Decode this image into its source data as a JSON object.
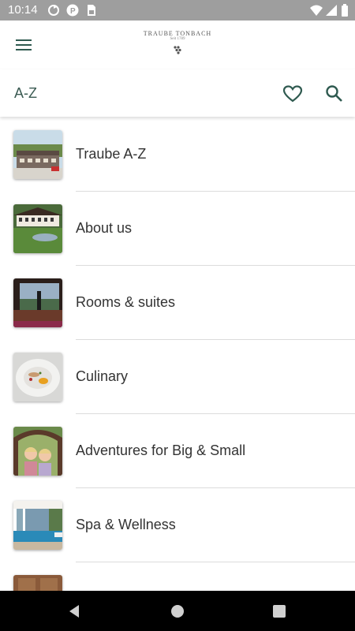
{
  "status_bar": {
    "time": "10:14",
    "icons": [
      "sync-icon",
      "p-badge-icon",
      "sim-card-icon",
      "wifi-icon",
      "signal-icon",
      "battery-icon"
    ]
  },
  "header": {
    "logo_name": "TRAUBE TONBACH",
    "logo_sub": "Seit 1789",
    "menu_icon": "hamburger-menu-icon"
  },
  "toolbar": {
    "title": "A-Z",
    "favorite_icon": "heart-icon",
    "search_icon": "search-icon"
  },
  "items": [
    {
      "label": "Traube A-Z"
    },
    {
      "label": "About us"
    },
    {
      "label": "Rooms & suites"
    },
    {
      "label": "Culinary"
    },
    {
      "label": "Adventures for Big & Small"
    },
    {
      "label": "Spa & Wellness"
    },
    {
      "label": ""
    }
  ],
  "nav": {
    "back_icon": "back-triangle-icon",
    "home_icon": "home-circle-icon",
    "recents_icon": "recents-square-icon"
  },
  "colors": {
    "status_bar": "#9e9e9e",
    "accent": "#2f5a50",
    "text": "#333333"
  }
}
